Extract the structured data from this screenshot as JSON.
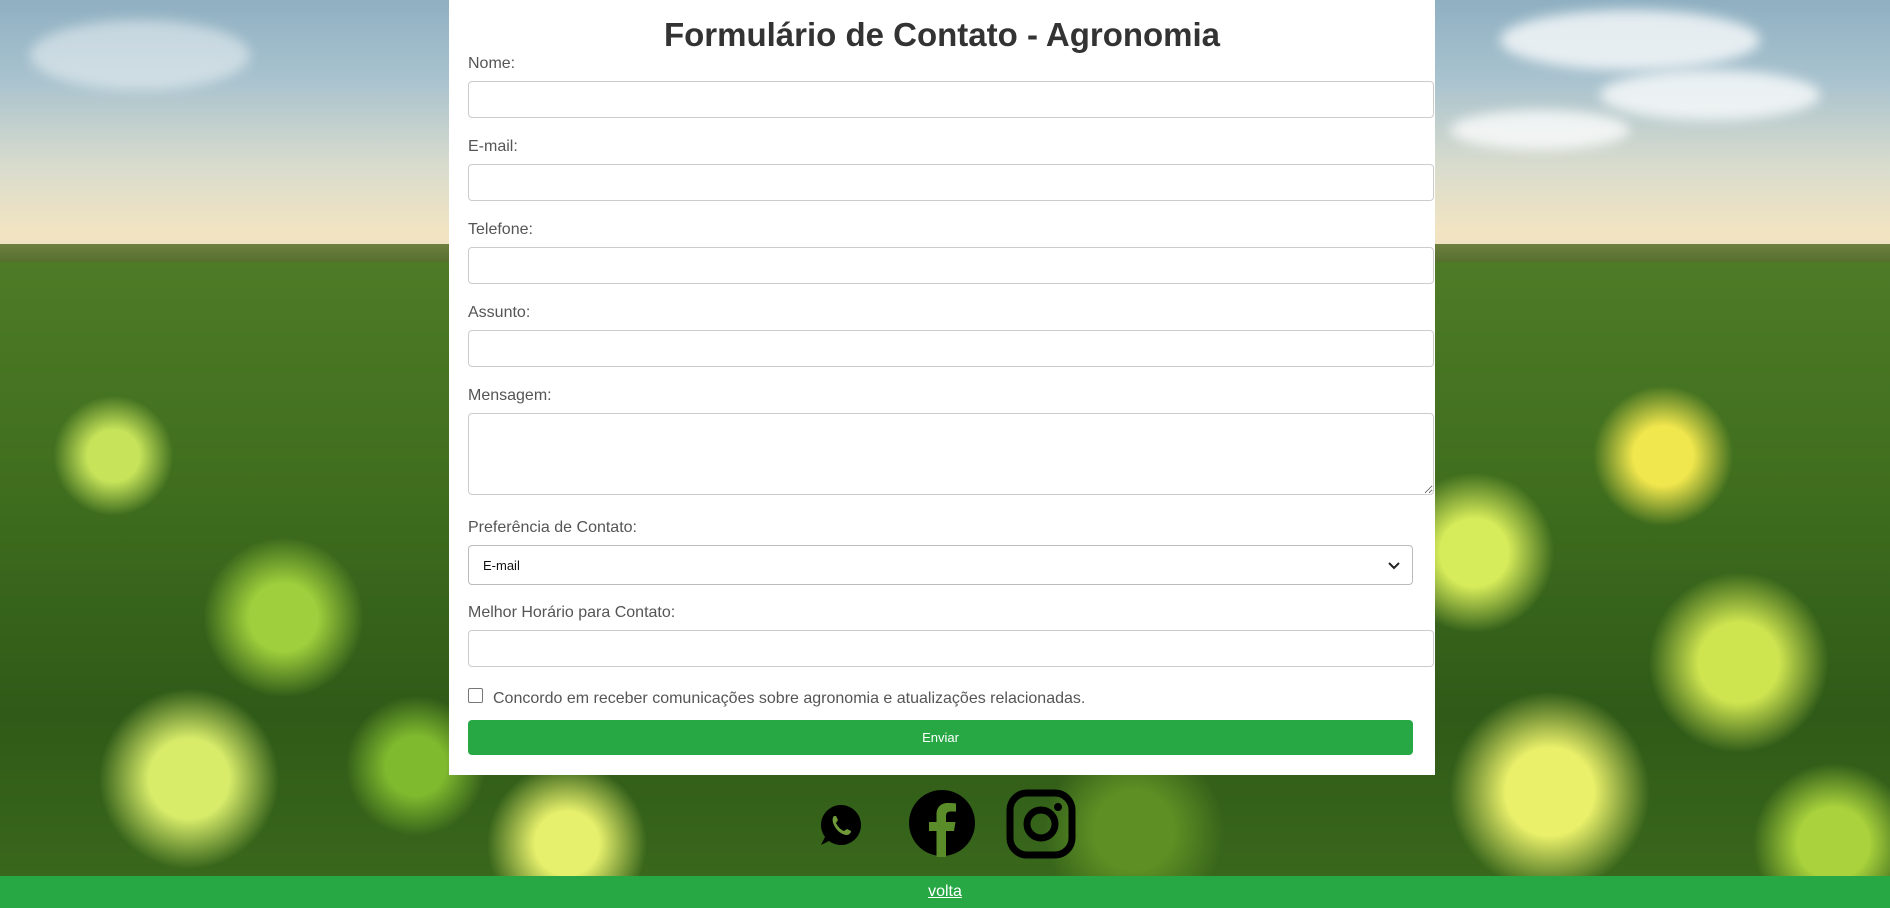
{
  "form": {
    "title": "Formulário de Contato - Agronomia",
    "fields": {
      "nome": {
        "label": "Nome:",
        "value": ""
      },
      "email": {
        "label": "E-mail:",
        "value": ""
      },
      "telefone": {
        "label": "Telefone:",
        "value": ""
      },
      "assunto": {
        "label": "Assunto:",
        "value": ""
      },
      "mensagem": {
        "label": "Mensagem:",
        "value": ""
      },
      "preferencia": {
        "label": "Preferência de Contato:",
        "selected": "E-mail"
      },
      "horario": {
        "label": "Melhor Horário para Contato:",
        "value": ""
      }
    },
    "consent_label": "Concordo em receber comunicações sobre agronomia e atualizações relacionadas.",
    "consent_checked": false,
    "submit_label": "Enviar"
  },
  "social": [
    {
      "name": "whatsapp-icon"
    },
    {
      "name": "facebook-icon"
    },
    {
      "name": "instagram-icon"
    }
  ],
  "footer": {
    "link_label": "volta"
  },
  "colors": {
    "accent": "#28a745",
    "title": "#333333",
    "label": "#555555",
    "card": "#ffffff"
  }
}
